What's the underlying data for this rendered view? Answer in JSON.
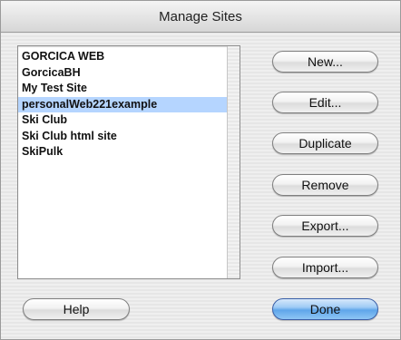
{
  "window": {
    "title": "Manage Sites"
  },
  "sites": [
    "GORCICA WEB",
    "GorcicaBH",
    "My Test Site",
    "personalWeb221example",
    "Ski Club",
    "Ski Club html site",
    "SkiPulk"
  ],
  "selected_site": "personalWeb221example",
  "buttons": {
    "new": "New...",
    "edit": "Edit...",
    "duplicate": "Duplicate",
    "remove": "Remove",
    "export": "Export...",
    "import": "Import...",
    "help": "Help",
    "done": "Done"
  },
  "colors": {
    "selection": "#b5d5ff",
    "default_button": "#5fa6ea"
  }
}
